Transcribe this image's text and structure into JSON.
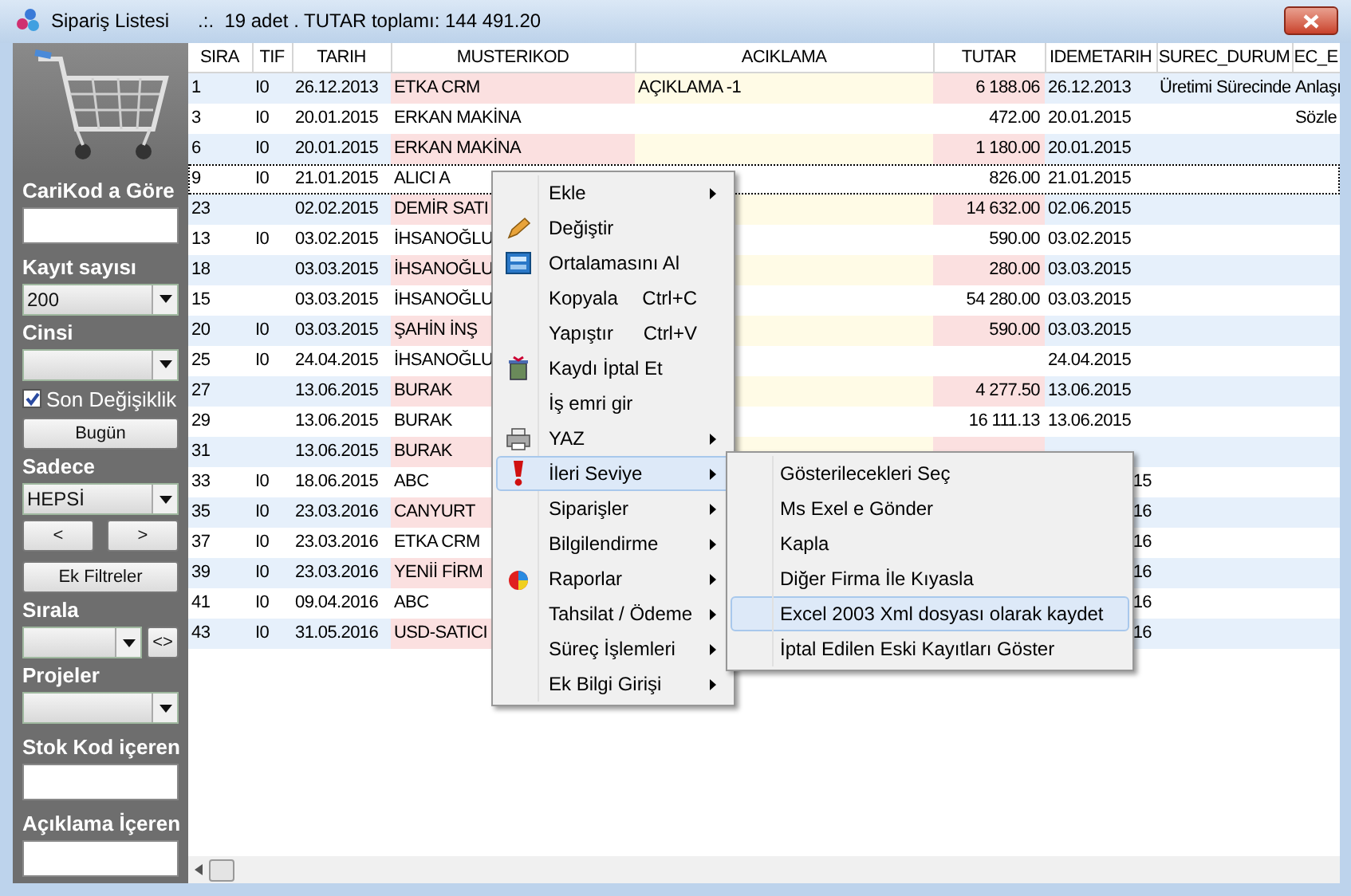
{
  "window": {
    "title": "Sipariş Listesi",
    "summary": ".:.  19 adet . TUTAR toplamı: 144 491.20"
  },
  "filters": {
    "carikod_label": "CariKod a Göre",
    "kayit_label": "Kayıt sayısı",
    "kayit_value": "200",
    "cinsi_label": "Cinsi",
    "son_degisiklik": {
      "label": "Son Değişiklik",
      "checked": true
    },
    "bugun_button": "Bugün",
    "sadece_label": "Sadece",
    "sadece_value": "HEPSİ",
    "prev_button": "<",
    "next_button": ">",
    "ek_filtreler_button": "Ek Filtreler",
    "sirala_label": "Sırala",
    "sirala_toggle": "<>",
    "projeler_label": "Projeler",
    "stok_label": "Stok Kod içeren",
    "aciklama_label": "Açıklama İçeren"
  },
  "table": {
    "columns": [
      "SIRA",
      "TIF",
      "TARIH",
      "MUSTERIKOD",
      "ACIKLAMA",
      "TUTAR",
      "IDEMETARIH",
      "SUREC_DURUM",
      "EC_E"
    ],
    "rows": [
      {
        "cells": [
          "1",
          "I0",
          "26.12.2013",
          "ETKA CRM",
          "AÇIKLAMA -1",
          "6 188.06",
          "26.12.2013",
          "Üretimi Sürecinde",
          "Anlaşı"
        ],
        "selected": false
      },
      {
        "cells": [
          "3",
          "I0",
          "20.01.2015",
          "ERKAN MAKİNA",
          "",
          "472.00",
          "20.01.2015",
          "",
          "Sözle"
        ],
        "selected": false
      },
      {
        "cells": [
          "6",
          "I0",
          "20.01.2015",
          "ERKAN MAKİNA",
          "",
          "1 180.00",
          "20.01.2015",
          "",
          ""
        ],
        "selected": false
      },
      {
        "cells": [
          "9",
          "I0",
          "21.01.2015",
          "ALICI A",
          "",
          "826.00",
          "21.01.2015",
          "",
          ""
        ],
        "selected": true
      },
      {
        "cells": [
          "23",
          "",
          "02.02.2015",
          "DEMİR SATI",
          "",
          "14 632.00",
          "02.06.2015",
          "",
          ""
        ],
        "selected": false
      },
      {
        "cells": [
          "13",
          "I0",
          "03.02.2015",
          "İHSANOĞLU",
          "",
          "590.00",
          "03.02.2015",
          "",
          ""
        ],
        "selected": false
      },
      {
        "cells": [
          "18",
          "",
          "03.03.2015",
          "İHSANOĞLU",
          "",
          "280.00",
          "03.03.2015",
          "",
          ""
        ],
        "selected": false
      },
      {
        "cells": [
          "15",
          "",
          "03.03.2015",
          "İHSANOĞLU",
          "",
          "54 280.00",
          "03.03.2015",
          "",
          ""
        ],
        "selected": false
      },
      {
        "cells": [
          "20",
          "I0",
          "03.03.2015",
          "ŞAHİN İNŞ",
          "",
          "590.00",
          "03.03.2015",
          "",
          ""
        ],
        "selected": false
      },
      {
        "cells": [
          "25",
          "I0",
          "24.04.2015",
          "İHSANOĞLU",
          "",
          "",
          "24.04.2015",
          "",
          ""
        ],
        "selected": false
      },
      {
        "cells": [
          "27",
          "",
          "13.06.2015",
          "BURAK",
          "",
          "4 277.50",
          "13.06.2015",
          "",
          ""
        ],
        "selected": false
      },
      {
        "cells": [
          "29",
          "",
          "13.06.2015",
          "BURAK",
          "",
          "16 111.13",
          "13.06.2015",
          "",
          ""
        ],
        "selected": false
      },
      {
        "cells": [
          "31",
          "",
          "13.06.2015",
          "BURAK",
          "",
          "",
          "",
          "",
          ""
        ],
        "selected": false
      },
      {
        "cells": [
          "33",
          "I0",
          "18.06.2015",
          "ABC",
          "",
          "",
          "15",
          "",
          ""
        ],
        "selected": false
      },
      {
        "cells": [
          "35",
          "I0",
          "23.03.2016",
          "CANYURT",
          "",
          "",
          "16",
          "",
          ""
        ],
        "selected": false
      },
      {
        "cells": [
          "37",
          "I0",
          "23.03.2016",
          "ETKA CRM",
          "",
          "",
          "16",
          "",
          ""
        ],
        "selected": false
      },
      {
        "cells": [
          "39",
          "I0",
          "23.03.2016",
          "YENİİ FİRM",
          "",
          "",
          "16",
          "",
          ""
        ],
        "selected": false
      },
      {
        "cells": [
          "41",
          "I0",
          "09.04.2016",
          "ABC",
          "",
          "",
          "16",
          "",
          ""
        ],
        "selected": false
      },
      {
        "cells": [
          "43",
          "I0",
          "31.05.2016",
          "USD-SATICI",
          "",
          "",
          "16",
          "",
          ""
        ],
        "selected": false
      }
    ]
  },
  "context_menu": {
    "items": [
      {
        "label": "Ekle",
        "submenu": true,
        "selected": false
      },
      {
        "label": "Değiştir",
        "submenu": false,
        "selected": false
      },
      {
        "label": "Ortalamasını Al",
        "submenu": false,
        "selected": false
      },
      {
        "label": "Kopyala",
        "shortcut": "Ctrl+C",
        "submenu": false,
        "selected": false
      },
      {
        "label": "Yapıştır",
        "shortcut": "Ctrl+V",
        "submenu": false,
        "selected": false
      },
      {
        "label": "Kaydı İptal Et",
        "submenu": false,
        "selected": false
      },
      {
        "label": "İş emri gir",
        "submenu": false,
        "selected": false
      },
      {
        "label": "YAZ",
        "submenu": true,
        "selected": false
      },
      {
        "label": "İleri Seviye",
        "submenu": true,
        "selected": true
      },
      {
        "label": "Siparişler",
        "submenu": true,
        "selected": false
      },
      {
        "label": "Bilgilendirme",
        "submenu": true,
        "selected": false
      },
      {
        "label": "Raporlar",
        "submenu": true,
        "selected": false
      },
      {
        "label": "Tahsilat / Ödeme",
        "submenu": true,
        "selected": false
      },
      {
        "label": "Süreç İşlemleri",
        "submenu": true,
        "selected": false
      },
      {
        "label": "Ek Bilgi Girişi",
        "submenu": true,
        "selected": false
      }
    ]
  },
  "submenu": {
    "items": [
      {
        "label": "Gösterilecekleri Seç",
        "selected": false
      },
      {
        "label": "Ms Exel e Gönder",
        "selected": false
      },
      {
        "label": "Kapla",
        "selected": false
      },
      {
        "label": "Diğer Firma İle Kıyasla",
        "selected": false
      },
      {
        "label": "Excel 2003 Xml dosyası olarak kaydet",
        "selected": true
      },
      {
        "label": "İptal Edilen Eski Kayıtları Göster",
        "selected": false
      }
    ]
  }
}
